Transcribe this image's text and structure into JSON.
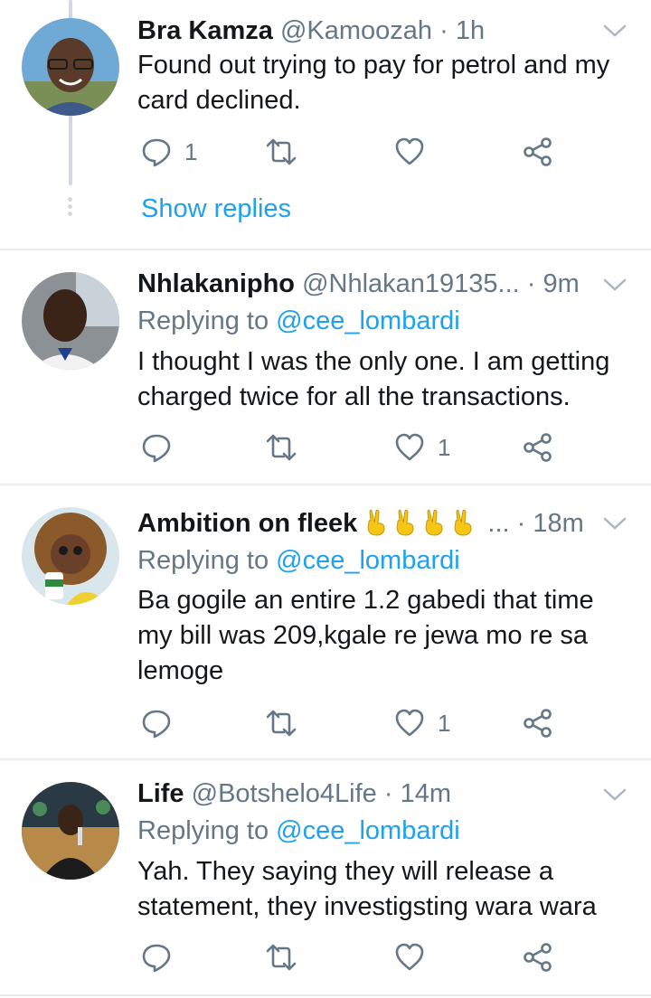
{
  "tweets": [
    {
      "name": "Bra Kamza",
      "handle": "@Kamoozah",
      "time": "· 1h",
      "reply_prefix": "",
      "reply_mention": "",
      "text": "Found out trying to pay for petrol and my card declined.",
      "reply_count": "1",
      "retweet_count": "",
      "like_count": "",
      "show_replies": "Show replies"
    },
    {
      "name": "Nhlakanipho",
      "handle": "@Nhlakan19135...",
      "time": "· 9m",
      "reply_prefix": "Replying to ",
      "reply_mention": "@cee_lombardi",
      "text": "I thought I was the only one. I am getting charged twice for all the transactions.",
      "reply_count": "",
      "retweet_count": "",
      "like_count": "1"
    },
    {
      "name": "Ambition on fleek",
      "name_suffix": "...",
      "handle": "",
      "time": "· 18m",
      "reply_prefix": "Replying to ",
      "reply_mention": "@cee_lombardi",
      "text": "Ba gogile an entire 1.2 gabedi that time my bill was 209,kgale re jewa mo re sa lemoge",
      "reply_count": "",
      "retweet_count": "",
      "like_count": "1"
    },
    {
      "name": "Life",
      "handle": "@Botshelo4Life",
      "time": "· 14m",
      "reply_prefix": "Replying to ",
      "reply_mention": "@cee_lombardi",
      "text": "Yah. They saying they will release a statement,  they investigsting wara wara",
      "reply_count": "",
      "retweet_count": "",
      "like_count": ""
    }
  ],
  "icons": {
    "reply": "reply-icon",
    "retweet": "retweet-icon",
    "like": "heart-icon",
    "share": "share-icon",
    "menu": "chevron-down-icon",
    "emoji": "victory-hand-emoji"
  },
  "colors": {
    "accent": "#1da1f2",
    "secondary_text": "#657786",
    "divider": "#e6ecf0"
  }
}
